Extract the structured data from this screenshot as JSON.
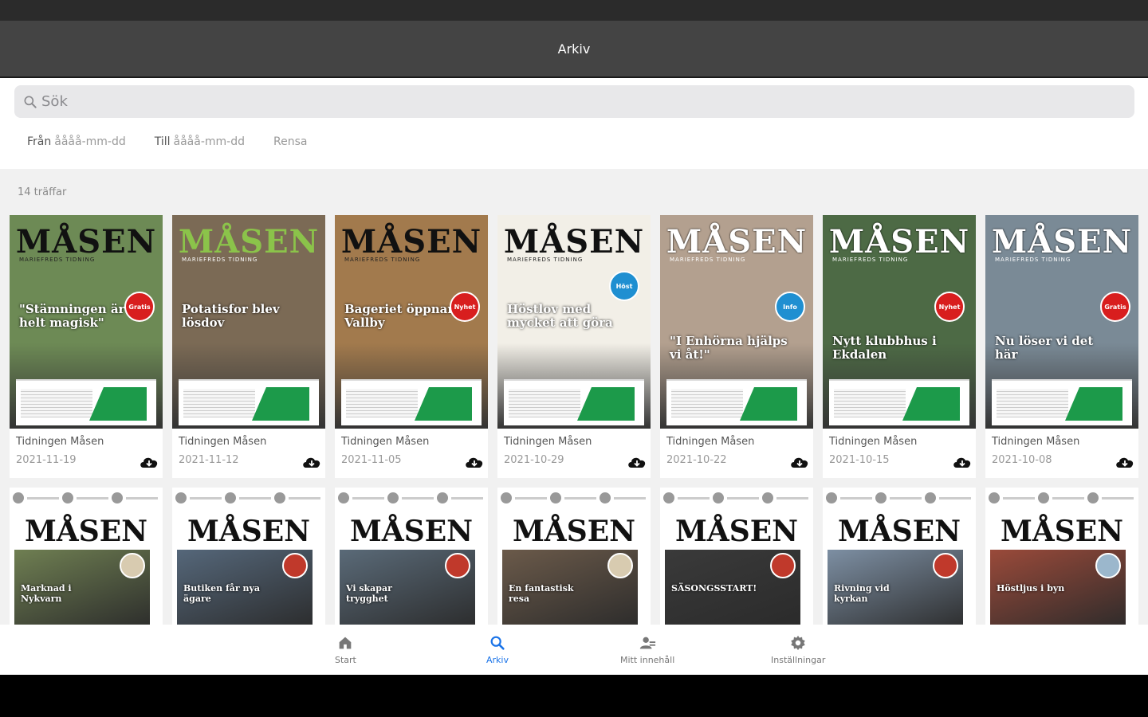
{
  "appbar": {
    "title": "Arkiv"
  },
  "search": {
    "placeholder": "Sök"
  },
  "filters": {
    "from_label": "Från",
    "from_placeholder": "åååå-mm-dd",
    "to_label": "Till",
    "to_placeholder": "åååå-mm-dd",
    "clear_label": "Rensa"
  },
  "results": {
    "count_text": "14 träffar"
  },
  "issues": [
    {
      "name": "Tidningen Måsen",
      "date": "2021-11-19",
      "headline": "\"Stämningen är helt magisk\"",
      "badge": "Gratis",
      "bg": "#6d8a55",
      "masthead_style": "dark"
    },
    {
      "name": "Tidningen Måsen",
      "date": "2021-11-12",
      "headline": "Potatisfor blev lösdov",
      "badge": "",
      "bg": "#7b6a55",
      "masthead_style": "green"
    },
    {
      "name": "Tidningen Måsen",
      "date": "2021-11-05",
      "headline": "Bageriet öppnar i Vallby",
      "badge": "Nyhet",
      "bg": "#a27a4d",
      "masthead_style": "dark"
    },
    {
      "name": "Tidningen Måsen",
      "date": "2021-10-29",
      "headline": "Höstlov med mycket att göra",
      "badge": "Höst",
      "bg": "#f2efe7",
      "masthead_style": "dark"
    },
    {
      "name": "Tidningen Måsen",
      "date": "2021-10-22",
      "headline": "\"I Enhörna hjälps vi åt!\"",
      "badge": "Info",
      "bg": "#b3a08f",
      "masthead_style": "light"
    },
    {
      "name": "Tidningen Måsen",
      "date": "2021-10-15",
      "headline": "Nytt klubbhus i Ekdalen",
      "badge": "Nyhet",
      "bg": "#4d6a45",
      "masthead_style": "light"
    },
    {
      "name": "Tidningen Måsen",
      "date": "2021-10-08",
      "headline": "Nu löser vi det här",
      "badge": "Gratis",
      "bg": "#7a8a96",
      "masthead_style": "light"
    }
  ],
  "older_issues": [
    {
      "headline": "Marknad i Nykvarn",
      "bg": "#6f7f52",
      "badge_color": "#d8cbb0"
    },
    {
      "headline": "Butiken får nya ägare",
      "bg": "#55677a",
      "badge_color": "#c0392b"
    },
    {
      "headline": "Vi skapar trygghet",
      "bg": "#5a6a78",
      "badge_color": "#c0392b"
    },
    {
      "headline": "En fantastisk resa",
      "bg": "#6b5a4a",
      "badge_color": "#d8cbb0"
    },
    {
      "headline": "SÄSONGSSTART!",
      "bg": "#3a3a3a",
      "badge_color": "#c0392b"
    },
    {
      "headline": "Rivning vid kyrkan",
      "bg": "#7d8fa3",
      "badge_color": "#c0392b"
    },
    {
      "headline": "Höstljus i byn",
      "bg": "#9a4a3a",
      "badge_color": "#9bb7cc"
    }
  ],
  "masthead": "MÅSEN",
  "masthead_sub": "MARIEFREDS TIDNING",
  "tabs": [
    {
      "label": "Start",
      "icon": "home-icon",
      "active": false
    },
    {
      "label": "Arkiv",
      "icon": "search-icon",
      "active": true
    },
    {
      "label": "Mitt innehåll",
      "icon": "user-group-icon",
      "active": false
    },
    {
      "label": "Inställningar",
      "icon": "gear-icon",
      "active": false
    }
  ],
  "colors": {
    "accent": "#1a73e8",
    "appbar": "#444444"
  }
}
